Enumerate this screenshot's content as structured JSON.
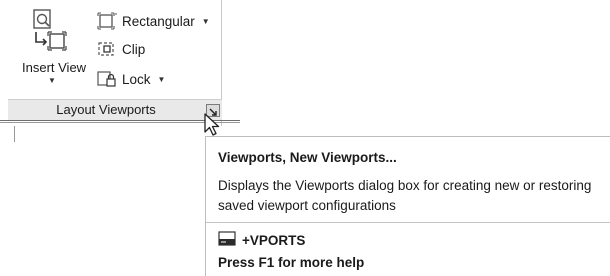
{
  "ribbon_panel": {
    "insert_view": {
      "label": "Insert View",
      "icon": "insert-view-icon",
      "dropdown_icon": "chevron-down-icon"
    },
    "commands": [
      {
        "label": "Rectangular",
        "icon": "rectangular-viewport-icon",
        "has_dropdown": true
      },
      {
        "label": "Clip",
        "icon": "clip-viewport-icon",
        "has_dropdown": false
      },
      {
        "label": "Lock",
        "icon": "lock-viewport-icon",
        "has_dropdown": true
      }
    ],
    "title": "Layout Viewports",
    "launcher_icon": "dialog-launcher-icon"
  },
  "tooltip": {
    "title": "Viewports, New Viewports...",
    "description": "Displays the Viewports dialog box for creating new or restoring saved viewport configurations",
    "command": "+VPORTS",
    "command_icon": "command-line-icon",
    "help": "Press F1 for more help"
  },
  "cursor_icon": "mouse-pointer-icon",
  "colors": {
    "panel_title_bg": "#e9e9e9",
    "border": "#bdbdbd",
    "text": "#1a1a1a"
  }
}
